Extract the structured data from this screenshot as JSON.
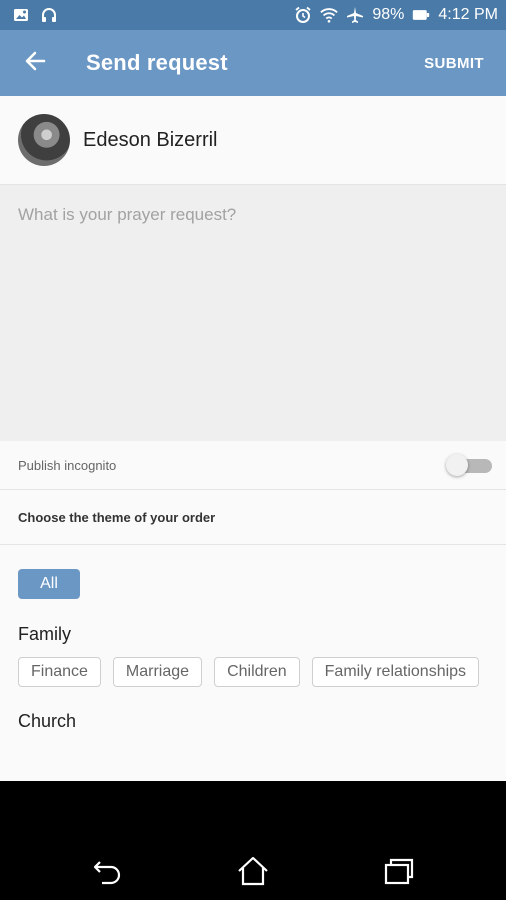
{
  "status_bar": {
    "battery": "98%",
    "time": "4:12 PM",
    "icons_left": [
      "image-icon",
      "headphones-icon"
    ],
    "icons_right": [
      "alarm-icon",
      "wifi-icon",
      "airplane-icon",
      "battery-icon"
    ]
  },
  "app_bar": {
    "title": "Send request",
    "submit_label": "SUBMIT",
    "back_icon": "arrow-back-icon"
  },
  "user": {
    "name": "Edeson Bizerril"
  },
  "request": {
    "placeholder": "What is your prayer request?"
  },
  "incognito": {
    "label": "Publish incognito",
    "enabled": false
  },
  "theme": {
    "label": "Choose the theme of your order",
    "all_label": "All",
    "groups": [
      {
        "title": "Family",
        "chips": [
          "Finance",
          "Marriage",
          "Children",
          "Family relationships"
        ]
      },
      {
        "title": "Church",
        "chips": []
      }
    ]
  },
  "colors": {
    "primary": "#6b97c5",
    "status_bar": "#4a7aa8"
  }
}
